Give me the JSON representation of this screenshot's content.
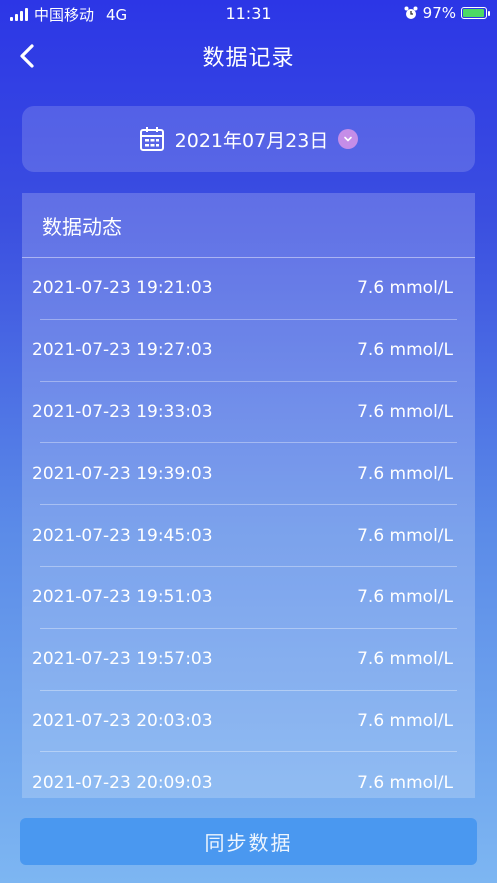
{
  "status_bar": {
    "carrier": "中国移动",
    "network": "4G",
    "time": "11:31",
    "battery": "97%",
    "battery_level": 0.97,
    "signal_bars": 4
  },
  "nav": {
    "title": "数据记录",
    "back_icon": "chevron-left-icon"
  },
  "date_picker": {
    "date": "2021年07月23日",
    "icon": "calendar-icon",
    "dropdown_icon": "chevron-down-icon",
    "dropdown_color": "#c58de8"
  },
  "records": {
    "title": "数据动态",
    "items": [
      {
        "time": "2021-07-23 19:21:03",
        "value": "7.6 mmol/L"
      },
      {
        "time": "2021-07-23 19:27:03",
        "value": "7.6 mmol/L"
      },
      {
        "time": "2021-07-23 19:33:03",
        "value": "7.6 mmol/L"
      },
      {
        "time": "2021-07-23 19:39:03",
        "value": "7.6 mmol/L"
      },
      {
        "time": "2021-07-23 19:45:03",
        "value": "7.6 mmol/L"
      },
      {
        "time": "2021-07-23 19:51:03",
        "value": "7.6 mmol/L"
      },
      {
        "time": "2021-07-23 19:57:03",
        "value": "7.6 mmol/L"
      },
      {
        "time": "2021-07-23 20:03:03",
        "value": "7.6 mmol/L"
      },
      {
        "time": "2021-07-23 20:09:03",
        "value": "7.6 mmol/L"
      }
    ]
  },
  "sync_button": {
    "label": "同步数据",
    "color": "#4a98f0"
  }
}
